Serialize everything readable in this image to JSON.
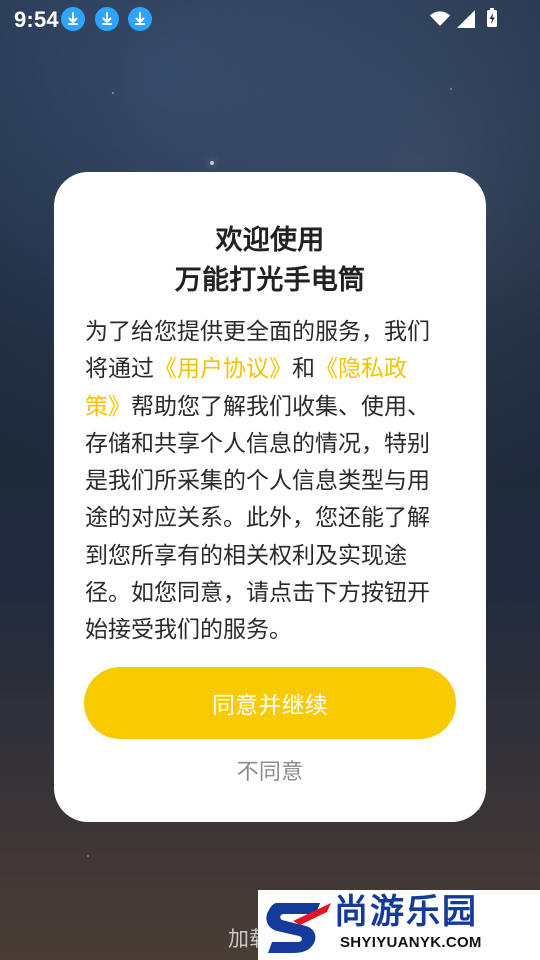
{
  "status_bar": {
    "time": "9:54",
    "icons": [
      "download-icon",
      "download-icon",
      "download-icon",
      "wifi-icon",
      "signal-icon",
      "battery-icon"
    ]
  },
  "dialog": {
    "title_line_1": "欢迎使用",
    "title_line_2": "万能打光手电筒",
    "body": {
      "line_1": "为了给您提供更全面的服务，我们",
      "line_2_prefix": "将通过",
      "user_agreement": "《用户协议》",
      "and_text": "和",
      "privacy_policy_part_1": "《隐私政",
      "privacy_policy_part_2": "策》",
      "line_3_suffix": "帮助您了解我们收集、使用、",
      "line_4": "存储和共享个人信息的情况，特别",
      "line_5": "是我们所采集的个人信息类型与用",
      "line_6": "途的对应关系。此外，您还能了解",
      "line_7": "到您所享有的相关权利及实现途",
      "line_8": "径。如您同意，请点击下方按钮开",
      "line_9": "始接受我们的服务。"
    },
    "agree_button": "同意并继续",
    "disagree_text": "不同意"
  },
  "background": {
    "loading_text": "加载"
  },
  "watermark": {
    "title": "尚游乐园",
    "url": "SHYIYUANYK.COM"
  },
  "colors": {
    "link": "#f3c300",
    "button": "#f8cb00",
    "dialog": "#ffffff",
    "body_text": "#2a2a2a",
    "muted_text": "#8c8c8c",
    "download_badge": "#2ea4ff",
    "watermark_primary": "#143b9b",
    "watermark_accent": "#e41624"
  }
}
